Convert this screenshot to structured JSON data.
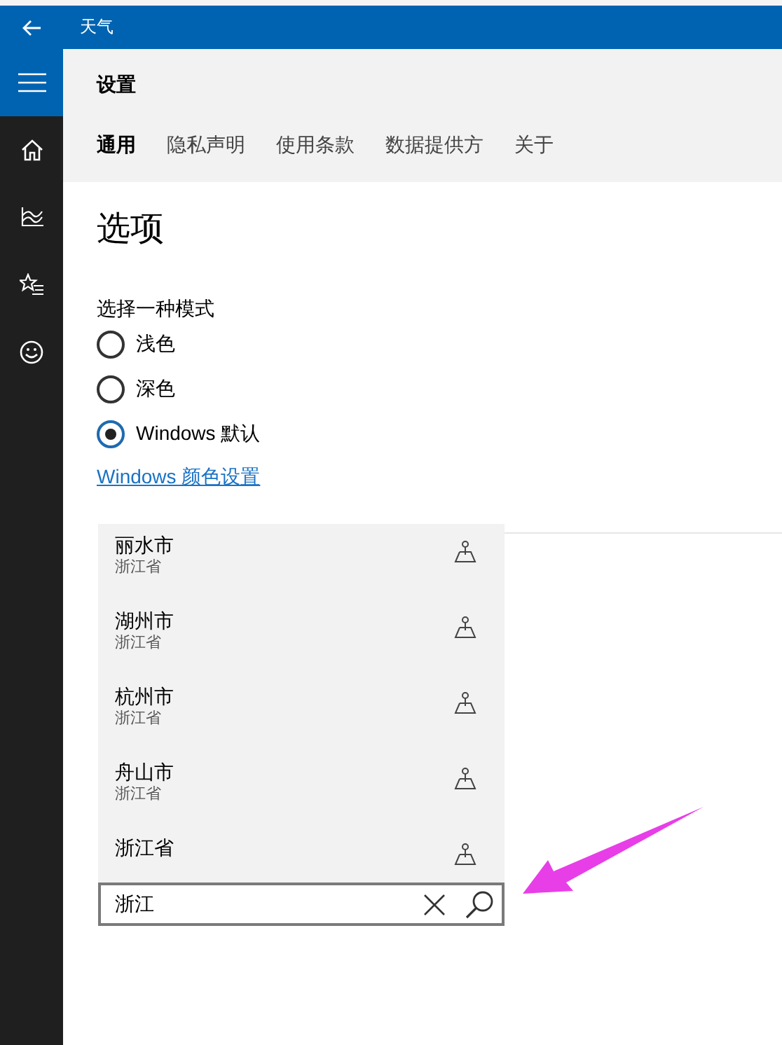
{
  "window": {
    "title": "天气"
  },
  "header": {
    "title": "设置",
    "tabs": [
      {
        "label": "通用",
        "selected": true
      },
      {
        "label": "隐私声明",
        "selected": false
      },
      {
        "label": "使用条款",
        "selected": false
      },
      {
        "label": "数据提供方",
        "selected": false
      },
      {
        "label": "关于",
        "selected": false
      }
    ]
  },
  "section": {
    "title": "选项",
    "mode_label": "选择一种模式",
    "modes": [
      {
        "label": "浅色",
        "selected": false
      },
      {
        "label": "深色",
        "selected": false
      },
      {
        "label": "Windows 默认",
        "selected": true
      }
    ],
    "link": "Windows 颜色设置"
  },
  "search": {
    "value": "浙江",
    "suggestions": [
      {
        "name": "丽水市",
        "region": "浙江省"
      },
      {
        "name": "湖州市",
        "region": "浙江省"
      },
      {
        "name": "杭州市",
        "region": "浙江省"
      },
      {
        "name": "舟山市",
        "region": "浙江省"
      },
      {
        "name": "浙江省"
      }
    ]
  }
}
